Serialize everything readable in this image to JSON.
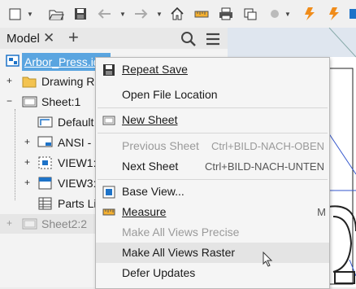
{
  "panel": {
    "tab_label": "Model",
    "close_glyph": "✕",
    "add_glyph": "+"
  },
  "tree": {
    "root_label": "Arbor_Press.idw",
    "items": [
      {
        "label": "Drawing Re"
      },
      {
        "label": "Sheet:1"
      },
      {
        "label": "Default"
      },
      {
        "label": "ANSI - L"
      },
      {
        "label": "VIEW1:"
      },
      {
        "label": "VIEW3:"
      },
      {
        "label": "Parts Lis"
      },
      {
        "label": "Sheet2:2"
      }
    ]
  },
  "menu": {
    "items": [
      {
        "label": "Repeat Save",
        "shortcut": "",
        "enabled": true,
        "icon": "save-icon"
      },
      {
        "label": "Open File Location",
        "shortcut": "",
        "enabled": true,
        "icon": ""
      },
      {
        "label": "New Sheet",
        "shortcut": "",
        "enabled": true,
        "icon": "new-sheet-icon"
      },
      {
        "label": "Previous Sheet",
        "shortcut": "Ctrl+BILD-NACH-OBEN",
        "enabled": false,
        "icon": ""
      },
      {
        "label": "Next Sheet",
        "shortcut": "Ctrl+BILD-NACH-UNTEN",
        "enabled": true,
        "icon": ""
      },
      {
        "label": "Base View...",
        "shortcut": "",
        "enabled": true,
        "icon": "base-view-icon"
      },
      {
        "label": "Measure",
        "shortcut": "M",
        "enabled": true,
        "icon": "measure-icon"
      },
      {
        "label": "Make All Views Precise",
        "shortcut": "",
        "enabled": false,
        "icon": ""
      },
      {
        "label": "Make All Views Raster",
        "shortcut": "",
        "enabled": true,
        "icon": ""
      },
      {
        "label": "Defer Updates",
        "shortcut": "",
        "enabled": true,
        "icon": ""
      }
    ]
  },
  "colors": {
    "accent": "#1e73c8",
    "root_highlight": "#5aa5e0",
    "highlight_row": "#e4e4e4",
    "disabled_text": "#9a9a9a"
  }
}
